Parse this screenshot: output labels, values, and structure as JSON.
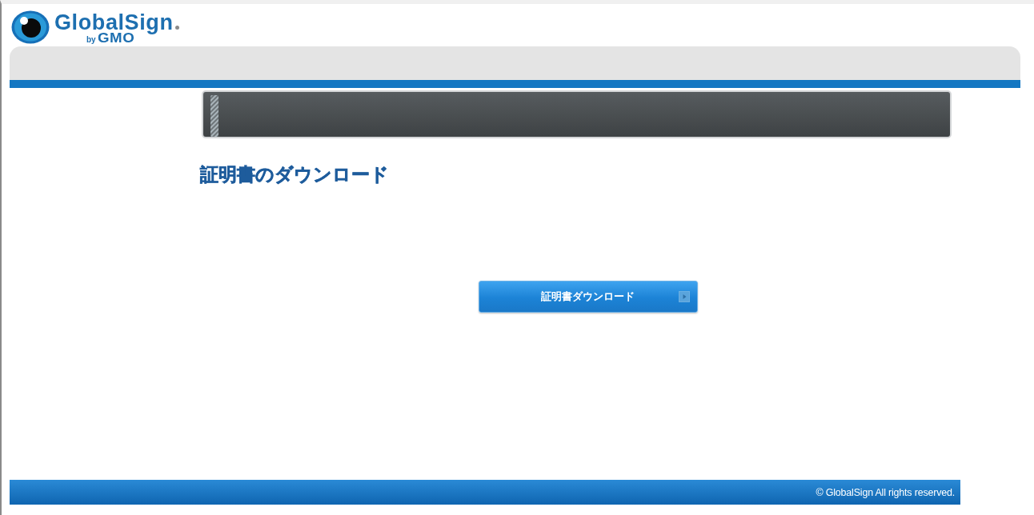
{
  "logo": {
    "name": "GlobalSign",
    "by": "by",
    "brand": "GMO"
  },
  "heading": "証明書のダウンロード",
  "download_button": {
    "label": "証明書ダウンロード"
  },
  "footer": {
    "copyright": "© GlobalSign All rights reserved."
  }
}
